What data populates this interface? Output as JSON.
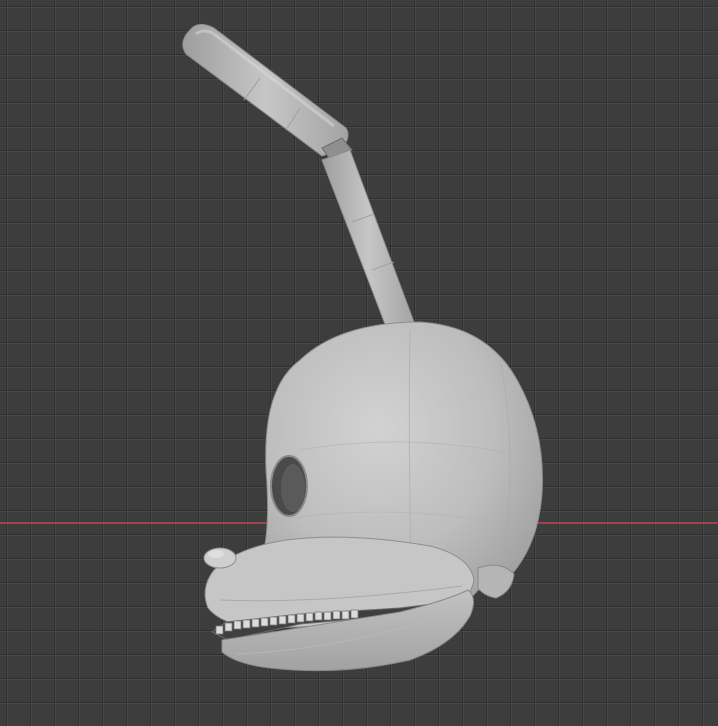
{
  "viewport": {
    "background_color": "#3d3d3d",
    "grid_line_color": "#2f2f2f",
    "x_axis_color": "#a8444f"
  },
  "model": {
    "icon": "rabbit-head-mesh",
    "clay_color": "#c4c4c4"
  }
}
